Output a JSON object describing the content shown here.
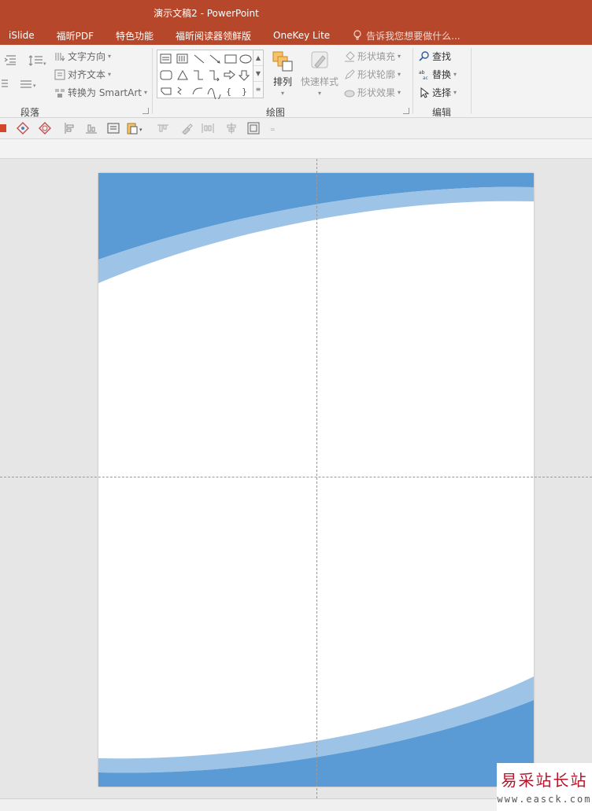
{
  "window": {
    "title": "演示文稿2 - PowerPoint"
  },
  "tabs": [
    {
      "label": "iSlide"
    },
    {
      "label": "福昕PDF"
    },
    {
      "label": "特色功能"
    },
    {
      "label": "福昕阅读器领鲜版"
    },
    {
      "label": "OneKey Lite"
    }
  ],
  "tell_me": {
    "placeholder": "告诉我您想要做什么..."
  },
  "ribbon": {
    "paragraph": {
      "label": "段落",
      "text_direction": "文字方向",
      "align_text": "对齐文本",
      "convert_smartart": "转换为 SmartArt"
    },
    "drawing": {
      "label": "绘图",
      "arrange": "排列",
      "quick_styles": "快速样式",
      "shape_fill": "形状填充",
      "shape_outline": "形状轮廓",
      "shape_effects": "形状效果"
    },
    "editing": {
      "label": "编辑",
      "find": "查找",
      "replace": "替换",
      "select": "选择"
    }
  },
  "colors": {
    "titlebar": "#b7472a",
    "slide_blue_dark": "#5b9bd5",
    "slide_blue_light": "#9dc3e6"
  },
  "watermark": {
    "title": "易采站长站",
    "url": "www.easck.com"
  }
}
